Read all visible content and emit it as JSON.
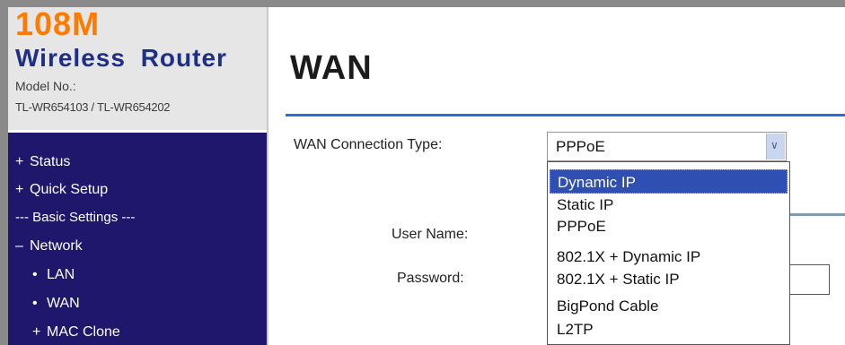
{
  "sidebar": {
    "brand_number": "108M",
    "brand_name": "Wireless Router",
    "model_label": "Model No.:",
    "model_value": "TL-WR654103 / TL-WR654202",
    "items": [
      {
        "marker": "+",
        "label": "Status"
      },
      {
        "marker": "+",
        "label": "Quick Setup"
      },
      {
        "label": "--- Basic Settings ---"
      },
      {
        "marker": "–",
        "label": "Network"
      },
      {
        "marker": "•",
        "label": "LAN"
      },
      {
        "marker": "•",
        "label": "WAN"
      },
      {
        "marker": "+",
        "label": "MAC Clone"
      }
    ]
  },
  "main": {
    "title": "WAN",
    "connection_type_label": "WAN Connection Type:",
    "connection_type_value": "PPPoE",
    "user_name_label": "User Name:",
    "password_label": "Password:",
    "options": [
      "Dynamic IP",
      "Static IP",
      "PPPoE",
      "802.1X + Dynamic IP",
      "802.1X + Static IP",
      "BigPond Cable",
      "L2TP"
    ],
    "highlighted_option": "Dynamic IP"
  },
  "colors": {
    "nav_bg": "#1e176b",
    "brand_orange": "#ff7b00",
    "brand_blue": "#1d2f86",
    "accent_rule": "#2a6fd6",
    "highlight": "#2f4fb2"
  },
  "icons": {
    "dropdown_arrow": "chevron-down-icon"
  }
}
